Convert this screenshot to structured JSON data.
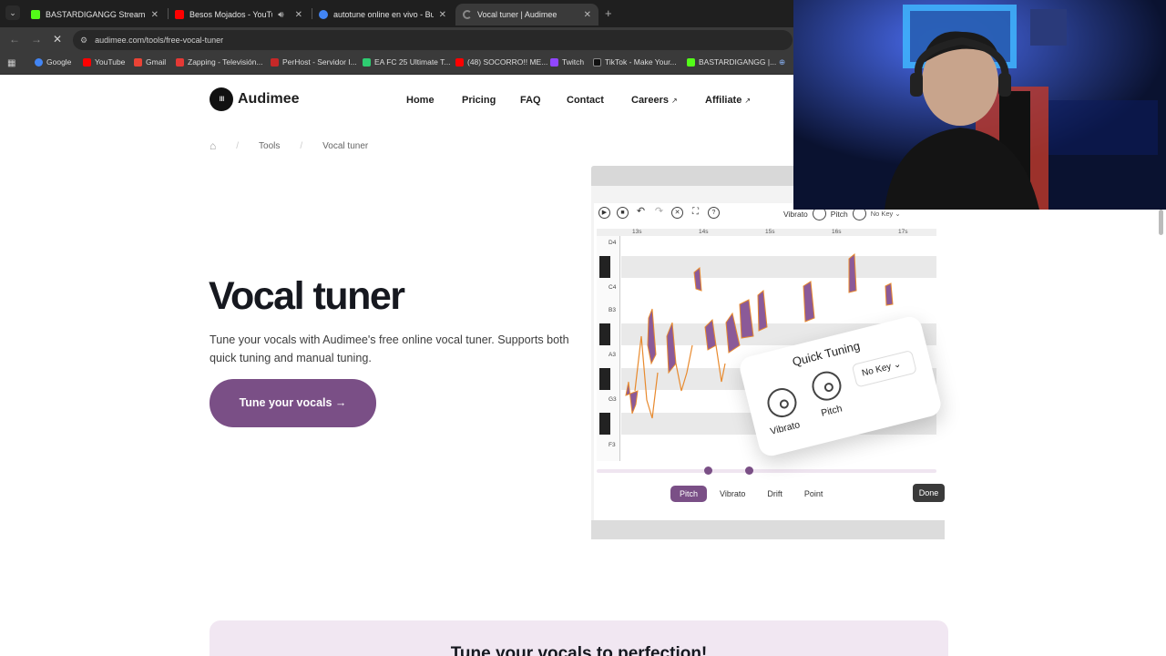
{
  "browser": {
    "tabs": [
      {
        "title": "BASTARDIGANGG Stream - Wat",
        "fav_color": "#53fc18",
        "active": false,
        "has_audio": false
      },
      {
        "title": "Besos Mojados - YouTube",
        "fav_color": "#ff0000",
        "active": false,
        "has_audio": true
      },
      {
        "title": "autotune online en vivo - Busca",
        "fav_color": "#4285f4",
        "active": false,
        "has_audio": false
      },
      {
        "title": "Vocal tuner | Audimee",
        "fav_color": "#888888",
        "active": true,
        "has_audio": false
      }
    ],
    "url": "audimee.com/tools/free-vocal-tuner",
    "bookmarks": [
      {
        "label": "Google",
        "fav_color": "#4285f4"
      },
      {
        "label": "YouTube",
        "fav_color": "#ff0000"
      },
      {
        "label": "Gmail",
        "fav_color": "#ea4335"
      },
      {
        "label": "Zapping - Televisión...",
        "fav_color": "#e53935"
      },
      {
        "label": "PerHost - Servidor I...",
        "fav_color": "#c62828"
      },
      {
        "label": "EA FC 25 Ultimate T...",
        "fav_color": "#2ecc71"
      },
      {
        "label": "(48) SOCORRO!! ME...",
        "fav_color": "#ff0000"
      },
      {
        "label": "Twitch",
        "fav_color": "#9146ff"
      },
      {
        "label": "TikTok - Make Your...",
        "fav_color": "#111111"
      },
      {
        "label": "BASTARDIGANGG |...",
        "fav_color": "#53fc18"
      }
    ]
  },
  "site": {
    "brand": "Audimee",
    "nav": [
      "Home",
      "Pricing",
      "FAQ",
      "Contact",
      "Careers",
      "Affiliate"
    ],
    "breadcrumbs": [
      "Tools",
      "Vocal tuner"
    ],
    "hero_title": "Vocal tuner",
    "hero_subtitle": "Tune your vocals with Audimee's free online vocal tuner. Supports both quick tuning and manual tuning.",
    "cta": "Tune your vocals →",
    "bottom_heading": "Tune your vocals to perfection!",
    "accent": "#7a4f86"
  },
  "editor": {
    "controls": {
      "vibrato": "Vibrato",
      "pitch": "Pitch",
      "key": "No Key"
    },
    "time_ticks": [
      "13s",
      "14s",
      "15s",
      "16s",
      "17s"
    ],
    "note_labels": [
      "D4",
      "C4",
      "B3",
      "A3",
      "G3",
      "F3"
    ],
    "modes": [
      "Pitch",
      "Vibrato",
      "Drift",
      "Point"
    ],
    "active_mode": "Pitch",
    "done": "Done",
    "quick_tuning": {
      "title": "Quick Tuning",
      "vibrato": "Vibrato",
      "pitch": "Pitch",
      "key": "No Key"
    }
  }
}
